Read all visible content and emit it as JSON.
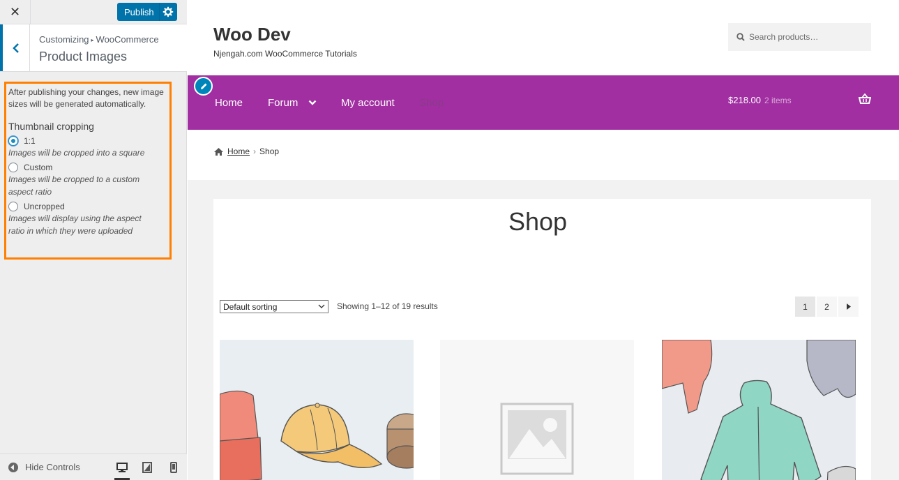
{
  "sidebar": {
    "publish_label": "Publish",
    "breadcrumb": {
      "root": "Customizing",
      "parent": "WooCommerce"
    },
    "section_title": "Product Images",
    "notice": "After publishing your changes, new image sizes will be generated automatically.",
    "cropping_title": "Thumbnail cropping",
    "options": [
      {
        "label": "1:1",
        "desc": "Images will be cropped into a square",
        "checked": true
      },
      {
        "label": "Custom",
        "desc": "Images will be cropped to a custom aspect ratio",
        "checked": false
      },
      {
        "label": "Uncropped",
        "desc": "Images will display using the aspect ratio in which they were uploaded",
        "checked": false
      }
    ],
    "hide_controls_label": "Hide Controls",
    "accent_color": "#0073aa",
    "highlight_color": "#ff7f00"
  },
  "preview": {
    "site_title": "Woo Dev",
    "site_description": "Njengah.com WooCommerce Tutorials",
    "search_placeholder": "Search products…",
    "nav": {
      "items": [
        "Home",
        "Forum",
        "My account",
        "Shop"
      ],
      "cart_total": "$218.00",
      "cart_count": "2 items",
      "color": "#a12fa1"
    },
    "breadcrumb": {
      "home": "Home",
      "current": "Shop"
    },
    "page_title": "Shop",
    "sorting": {
      "selected": "Default sorting"
    },
    "result_count": "Showing 1–12 of 19 results",
    "pagination": [
      "1",
      "2"
    ]
  }
}
